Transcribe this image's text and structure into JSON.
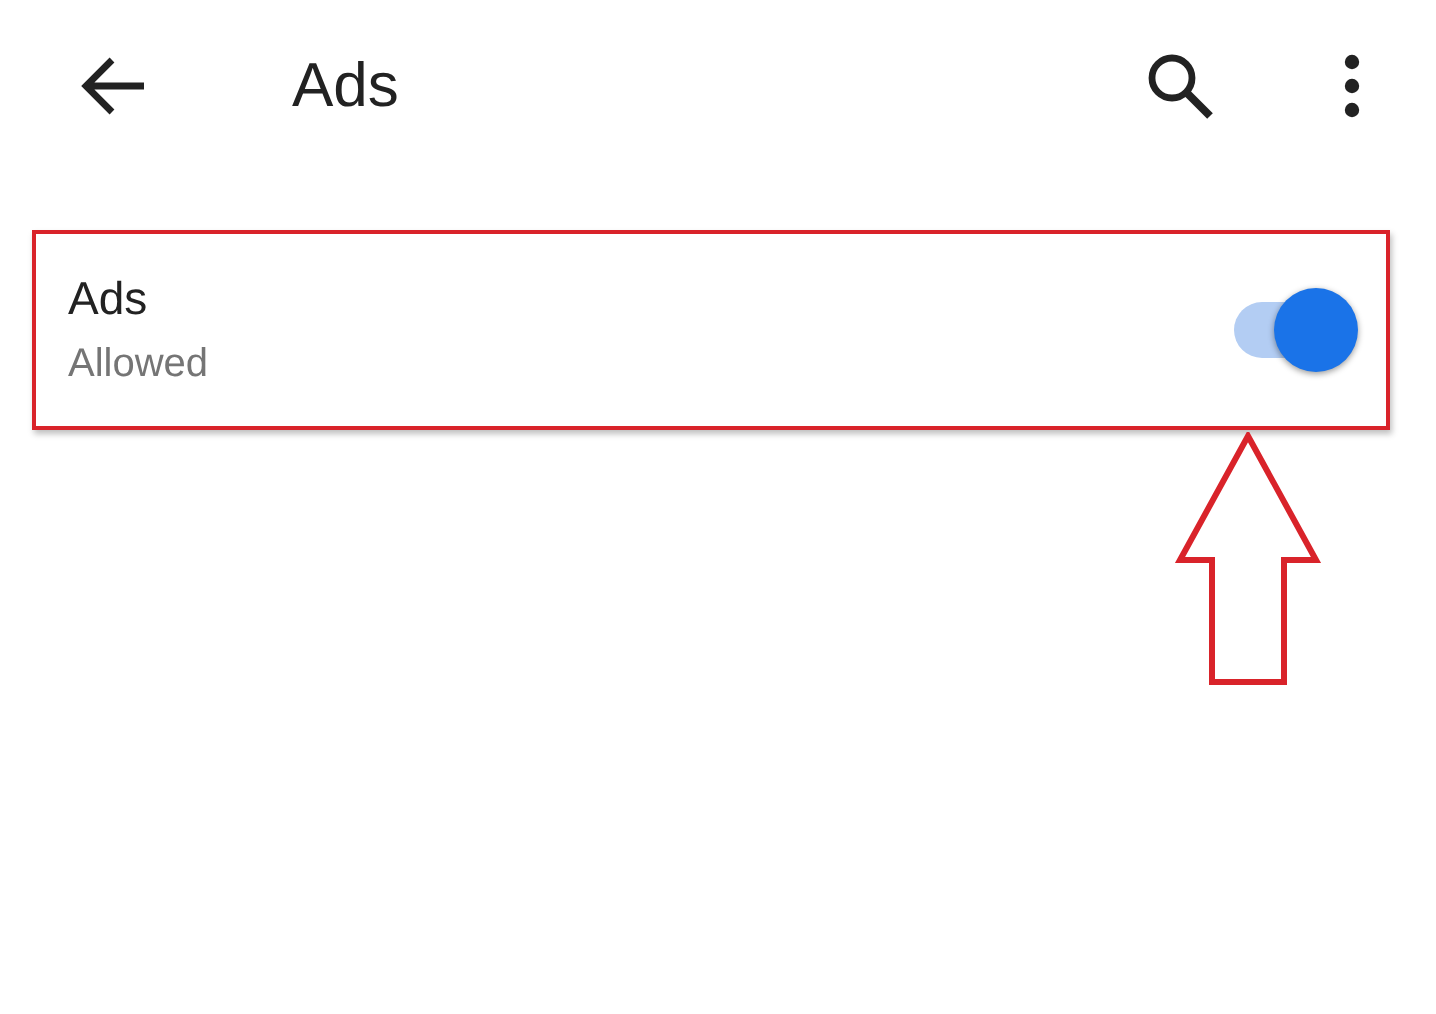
{
  "toolbar": {
    "title": "Ads"
  },
  "setting": {
    "title": "Ads",
    "summary": "Allowed",
    "on": true,
    "highlighted": true
  }
}
